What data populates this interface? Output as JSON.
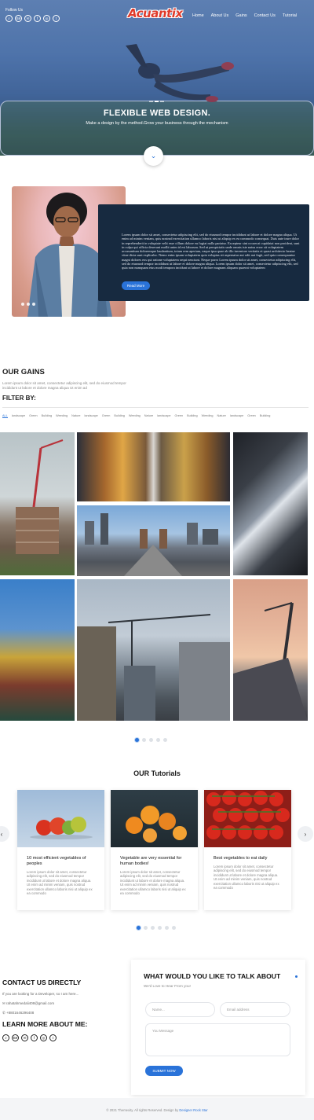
{
  "header": {
    "follow_label": "Follow Us",
    "social_icons": [
      "search-icon",
      "behance-icon",
      "mail-icon",
      "facebook-icon",
      "instagram-icon",
      "twitter-icon"
    ],
    "social_glyphs": [
      "⌕",
      "Bē",
      "✉",
      "f",
      "◎",
      "t"
    ],
    "logo": "Acuantix",
    "nav": [
      "Home",
      "About Us",
      "Gains",
      "Contact Us",
      "Tutorial"
    ]
  },
  "hero": {
    "title": "FLEXIBLE WEB DESIGN.",
    "subtitle": "Make a design by the method.Grow your business through the mechanism",
    "scroll_glyph": "⌄"
  },
  "about": {
    "text": "Lorem ipsum dolor sit amet, consectetur adipiscing elit, sed do eiusmod tempor incididunt ut labore et dolore magna aliqua. Ut enim ad minim veniam, quis nostrud exercitation ullamco laboris nisi ut aliquip ex ea commodo consequat. Duis aute irure dolor in reprehenderit in voluptate velit esse cillum dolore eu fugiat nulla pariatur. Excepteur sint occaecat cupidatat non proident, sunt in culpa qui officia deserunt mollit anim id est laborum. Sed ut perspiciatis unde omnis iste natus error sit voluptatem accusantium doloremque laudantium, totam rem aperiam, eaque ipsa quae ab illo inventore veritatis et quasi architecto beatae vitae dicta sunt explicabo. Nemo enim ipsam voluptatem quia voluptas sit aspernatur aut odit aut fugit, sed quia consequuntur magni dolores eos qui ratione voluptatem sequi nesciunt. Neque porro Lorem ipsum dolor sit amet, consectetur adipiscing elit, sed do eiusmod tempor incididunt ut labore et dolore magna aliqua. Lorem ipsum dolor sit amet, consectetur adipiscing elit, sed quia non numquam eius modi tempora incidunt ut labore et dolore magnam aliquam quaerat voluptatem",
    "read_more": "Read More"
  },
  "gains": {
    "title": "OUR GAINS",
    "description": "Lorem ipsum dolor sit amet, consectetur adipiscing elit, sed do eiusmod tempor incididunt ut labore et dolore magna aliqua Ut enim ad",
    "filter_title": "FILTER BY:",
    "filters": [
      "ALL",
      "landscape",
      "Green",
      "Building",
      "Weeding",
      "Nature",
      "landscape",
      "Green",
      "Building",
      "Weeding",
      "Nature",
      "landscape",
      "Green",
      "Building",
      "Weeding",
      "Nature",
      "landscape",
      "Green",
      "Building"
    ]
  },
  "tutorials": {
    "title": "OUR Tutorials",
    "prev_glyph": "‹",
    "next_glyph": "›",
    "cards": [
      {
        "title": "10 most efficient vegetables of peoples",
        "body": "Lorem ipsum dolor sit amet, consectetur adipiscing elit, sed do eiusmod tempor incididunt ut labore et dolore magna aliqua. Ut enim ad minim veniam, quis nostrud exercitation ullamco laboris nisi ut aliquip ex ea commodo"
      },
      {
        "title": "Vegetable are very essential for human bodies!",
        "body": "Lorem ipsum dolor sit amet, consectetur adipiscing elit, sed do eiusmod tempor incididunt ut labore et dolore magna aliqua. Ut enim ad minim veniam, quis nostrud exercitation ullamco laboris nisi ut aliquip ex ea commodo"
      },
      {
        "title": "Best vegetables to eat daily",
        "body": "Lorem ipsum dolor sit amet, consectetur adipiscing elit, sed do eiusmod tempor incididunt ut labore et dolore magna aliqua. Ut enim ad minim veniam, quis nostrud exercitation ullamco laboris nisi ut aliquip ex ea commodo"
      }
    ]
  },
  "contact": {
    "title": "CONTACT US DIRECTLY",
    "intro": "If you are looking for a Developer, so I am here...",
    "email_icon": "✉",
    "email": "rahatahmedali408@gmail.com",
    "phone_icon": "✆",
    "phone": "+8801646296408",
    "learn_title": "LEARN MORE ABOUT ME:",
    "form": {
      "title": "WHAT WOULD YOU LIKE TO TALK ABOUT",
      "subtitle": "We'd Love to Hear From you!",
      "name_placeholder": "Name...",
      "email_placeholder": "Email address",
      "message_placeholder": "You Message",
      "submit": "SUBMIT NOW"
    }
  },
  "footer": {
    "text": "© 2021 Themexity. All rights Reserved. Design by",
    "link": "Designer Rock Star"
  },
  "colors": {
    "accent": "#2a73d9",
    "dark_card": "#172a40",
    "logo_red": "#e03a2a"
  }
}
